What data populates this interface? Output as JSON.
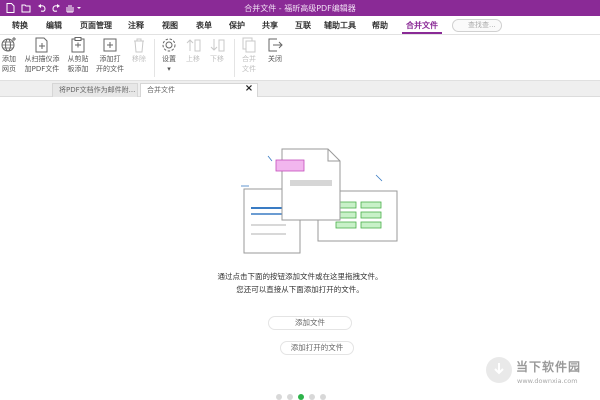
{
  "window": {
    "title": "合并文件 - 福昕高级PDF编辑器"
  },
  "menu": {
    "items": [
      {
        "label": "转换"
      },
      {
        "label": "编辑"
      },
      {
        "label": "页面管理"
      },
      {
        "label": "注释"
      },
      {
        "label": "视图"
      },
      {
        "label": "表单"
      },
      {
        "label": "保护"
      },
      {
        "label": "共享"
      },
      {
        "label": "互联"
      },
      {
        "label": "辅助工具"
      },
      {
        "label": "帮助"
      },
      {
        "label": "合并文件"
      }
    ],
    "active": "合并文件",
    "search_placeholder": "查找查..."
  },
  "ribbon": {
    "add_webpage": "添加网页",
    "add_webpage_l1": "添加",
    "add_webpage_l2": "网页",
    "scanner_l1": "从扫描仪添",
    "scanner_l2": "加PDF文件",
    "clipboard_l1": "从剪贴",
    "clipboard_l2": "板添加",
    "add_open_l1": "添加打",
    "add_open_l2": "开的文件",
    "remove": "移除",
    "settings": "设置",
    "move_up": "上移",
    "move_down": "下移",
    "merge_l1": "合并",
    "merge_l2": "文件",
    "close": "关闭"
  },
  "tabs": {
    "inactive": "将PDF文档作为邮件附...",
    "active": "合并文件"
  },
  "main": {
    "hint_line1": "通过点击下面的按钮添加文件或在这里拖拽文件。",
    "hint_line2": "您还可以直接从下面添加打开的文件。",
    "add_files_button": "添加文件",
    "add_open_files_button": "添加打开的文件"
  },
  "pagination": {
    "total": 5,
    "current": 3
  },
  "watermark": {
    "cn": "当下软件园",
    "en": "www.downxia.com"
  },
  "colors": {
    "accent": "#8a2a96",
    "green": "#2db34a"
  }
}
